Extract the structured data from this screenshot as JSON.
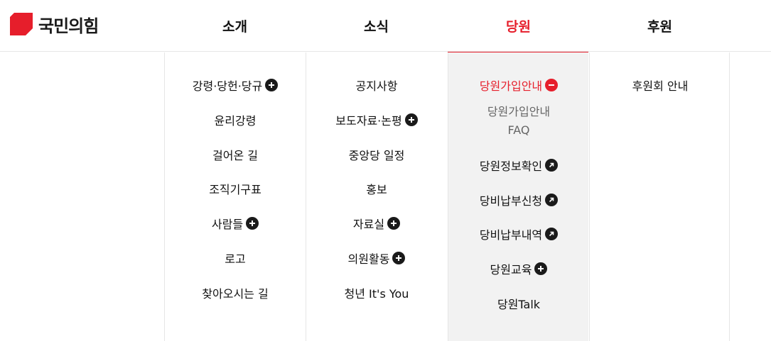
{
  "brand": {
    "name": "국민의힘",
    "color": "#e61e2b"
  },
  "nav": {
    "tabs": [
      {
        "label": "소개"
      },
      {
        "label": "소식"
      },
      {
        "label": "당원",
        "active": true
      },
      {
        "label": "후원"
      }
    ]
  },
  "menu": {
    "intro": [
      {
        "label": "강령·당헌·당규",
        "icon": "plus-icon"
      },
      {
        "label": "윤리강령"
      },
      {
        "label": "걸어온 길"
      },
      {
        "label": "조직기구표"
      },
      {
        "label": "사람들",
        "icon": "plus-icon"
      },
      {
        "label": "로고"
      },
      {
        "label": "찾아오시는 길"
      }
    ],
    "news": [
      {
        "label": "공지사항"
      },
      {
        "label": "보도자료·논평",
        "icon": "plus-icon"
      },
      {
        "label": "중앙당 일정"
      },
      {
        "label": "홍보"
      },
      {
        "label": "자료실",
        "icon": "plus-icon"
      },
      {
        "label": "의원활동",
        "icon": "plus-icon"
      },
      {
        "label": "청년 It's You"
      }
    ],
    "member": {
      "heading": "당원가입안내",
      "heading_icon": "minus-icon",
      "sub": [
        "당원가입안내",
        "FAQ"
      ],
      "items": [
        {
          "label": "당원정보확인",
          "icon": "external-link-icon"
        },
        {
          "label": "당비납부신청",
          "icon": "external-link-icon"
        },
        {
          "label": "당비납부내역",
          "icon": "external-link-icon"
        },
        {
          "label": "당원교육",
          "icon": "plus-icon"
        },
        {
          "label": "당원Talk"
        }
      ]
    },
    "support": [
      {
        "label": "후원회 안내"
      }
    ]
  }
}
